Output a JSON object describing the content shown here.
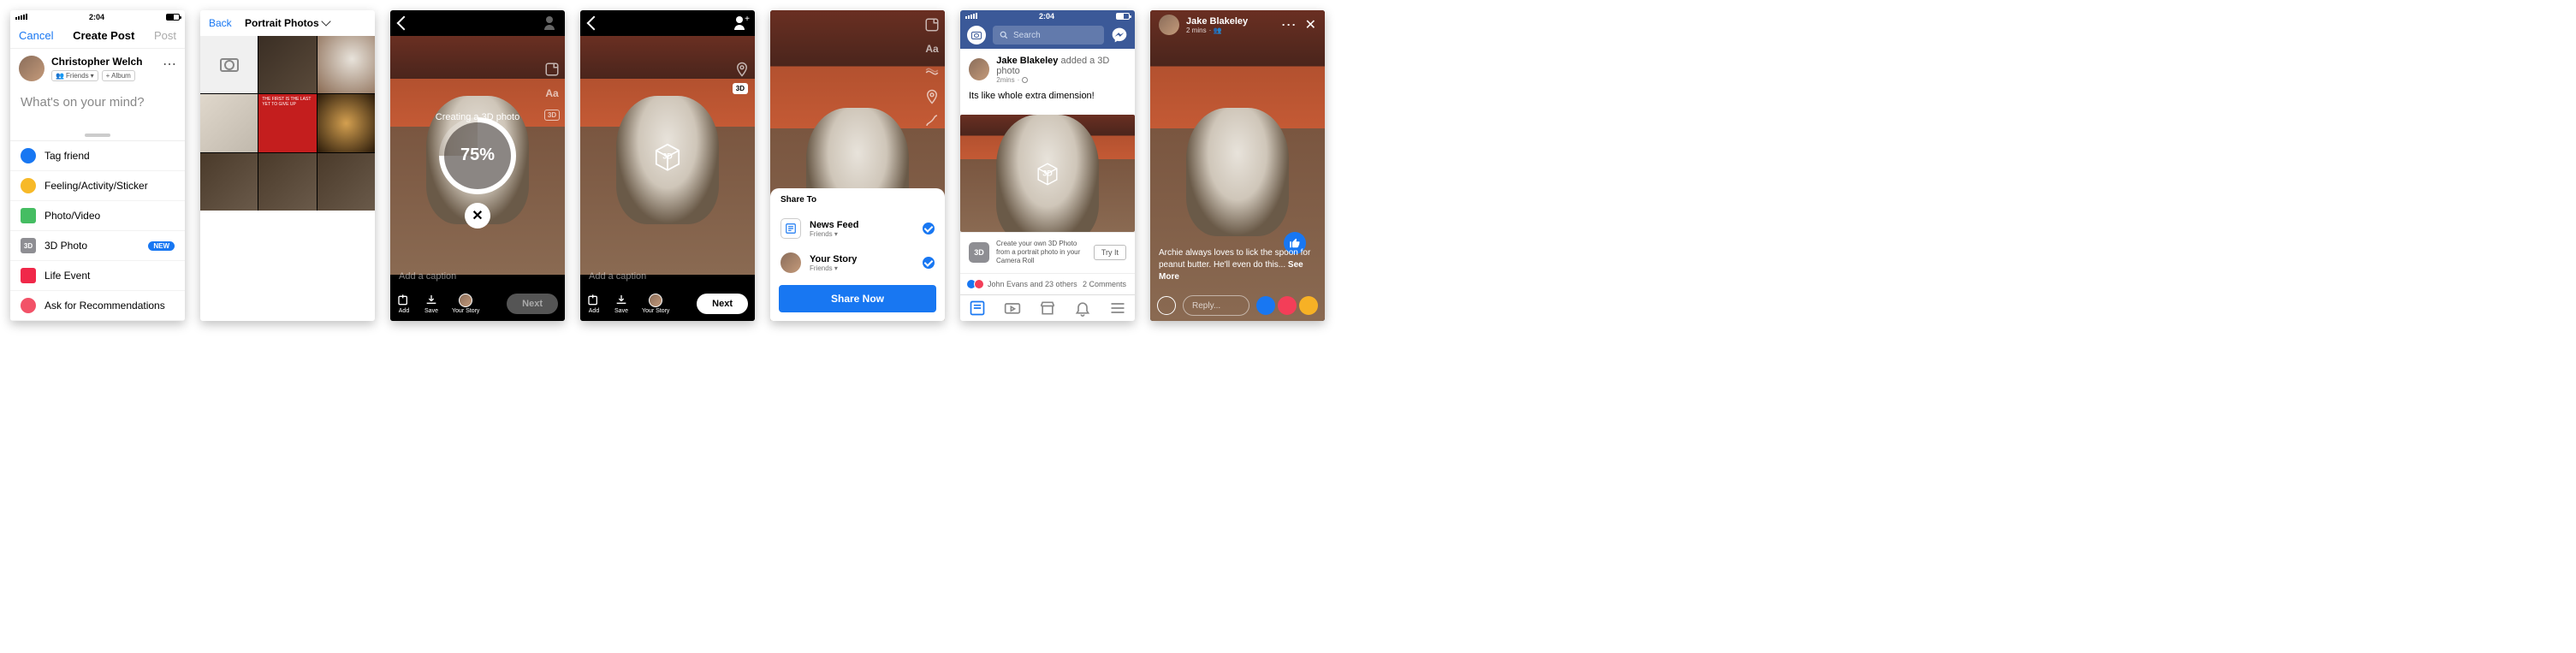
{
  "time": "2:04",
  "s1": {
    "cancel": "Cancel",
    "title": "Create Post",
    "post": "Post",
    "user": "Christopher Welch",
    "chip_friends": "Friends",
    "chip_album": "+ Album",
    "placeholder": "What's on your mind?",
    "menu": [
      {
        "label": "Tag friend"
      },
      {
        "label": "Feeling/Activity/Sticker"
      },
      {
        "label": "Photo/Video"
      },
      {
        "label": "3D Photo",
        "badge": "NEW"
      },
      {
        "label": "Life Event"
      },
      {
        "label": "Ask for Recommendations"
      }
    ]
  },
  "s2": {
    "back": "Back",
    "title": "Portrait Photos",
    "red_text": "THE FIRST IS THE LAST YET TO GIVE UP"
  },
  "cam": {
    "creating": "Creating a 3D photo",
    "progress": "75%",
    "caption_ph": "Add a caption",
    "cube": "3D",
    "add": "Add",
    "save": "Save",
    "story": "Your Story",
    "next": "Next",
    "badge3d": "3D"
  },
  "share": {
    "title": "Share To",
    "newsfeed": "News Feed",
    "yourstory": "Your Story",
    "sub": "Friends",
    "btn": "Share Now"
  },
  "feed": {
    "search_ph": "Search",
    "author": "Jake Blakeley",
    "action": "added a 3D photo",
    "time": "2mins",
    "body": "Its like whole extra dimension!",
    "cube": "3D",
    "promo": "Create your own 3D Photo from a portrait photo in your Camera Roll",
    "tryit": "Try It",
    "react_names": "John Evans and 23 others",
    "comments": "2 Comments",
    "promo_icon": "3D"
  },
  "full": {
    "author": "Jake Blakeley",
    "time": "2 mins",
    "caption": "Archie always loves to lick the spoon for peanut butter. He'll even do this... ",
    "more": "See More",
    "reply_ph": "Reply..."
  },
  "colors": {
    "fb_blue": "#1877f2",
    "fb_header": "#3b5998",
    "tag_blue": "#1877f2",
    "feeling_yellow": "#f7b928",
    "photo_green": "#45bd62",
    "3d_gray": "#8e8e93",
    "life_red": "#f02849",
    "ask_pink": "#f25268",
    "react_like": "#1877f2",
    "react_love": "#f33e58",
    "react_haha": "#f7b125"
  }
}
